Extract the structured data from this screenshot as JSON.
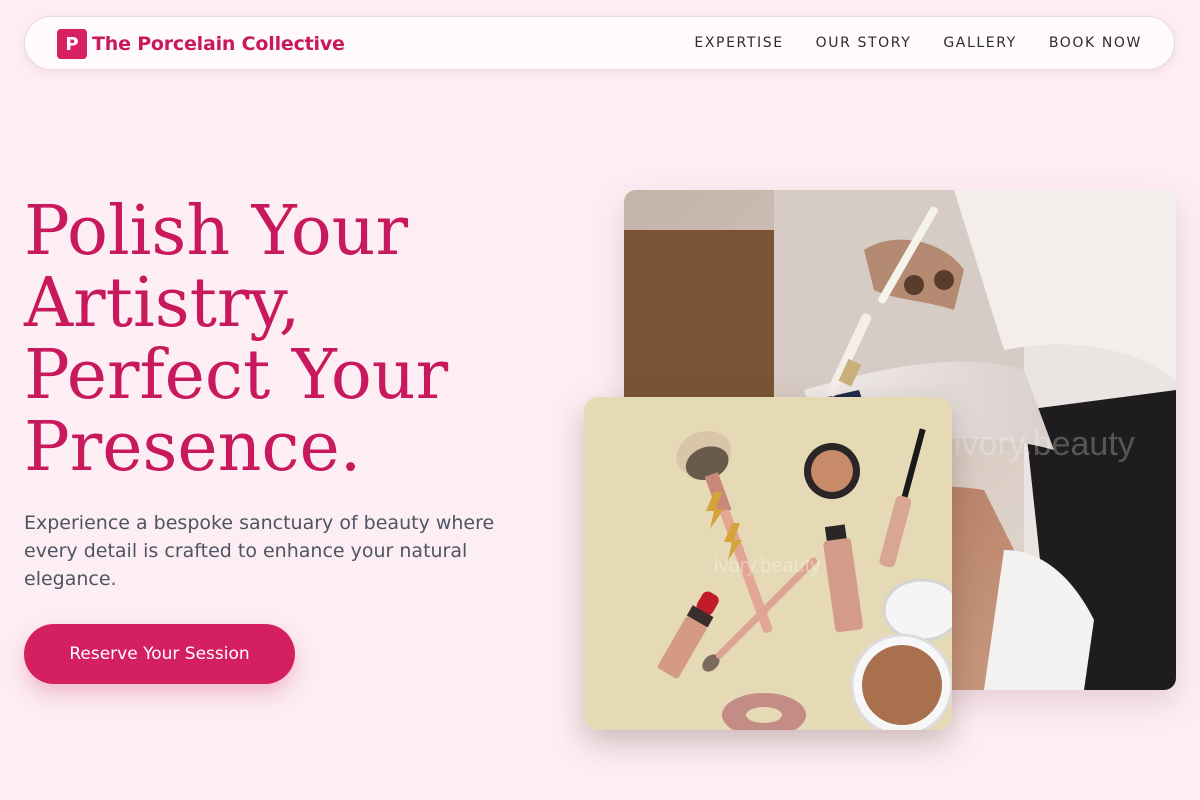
{
  "header": {
    "logo_letter": "P",
    "brand_name": "The Porcelain Collective",
    "nav": [
      "EXPERTISE",
      "OUR STORY",
      "GALLERY",
      "BOOK NOW"
    ]
  },
  "hero": {
    "title_lines": [
      "Polish Your",
      "Artistry,",
      "Perfect Your",
      "Presence."
    ],
    "description": "Experience a bespoke sanctuary of beauty where every detail is crafted to enhance your natural elegance.",
    "cta_label": "Reserve Your Session"
  },
  "images": {
    "main": "makeup artist applying foundation with a brush to a client's face",
    "secondary": "flat lay of makeup brushes, lipstick, mascara, powder compact and eyeshadow pots on a beige background",
    "watermark_main": "ivory.beauty",
    "watermark_sub": "ivory.beauty"
  },
  "icons": {
    "logo": "letter-p-logo-icon"
  },
  "colors": {
    "accent": "#d41f60",
    "heading": "#c7195b",
    "background": "#fdeef3",
    "body_text": "#4e5562",
    "nav_text": "#2b2b33"
  }
}
